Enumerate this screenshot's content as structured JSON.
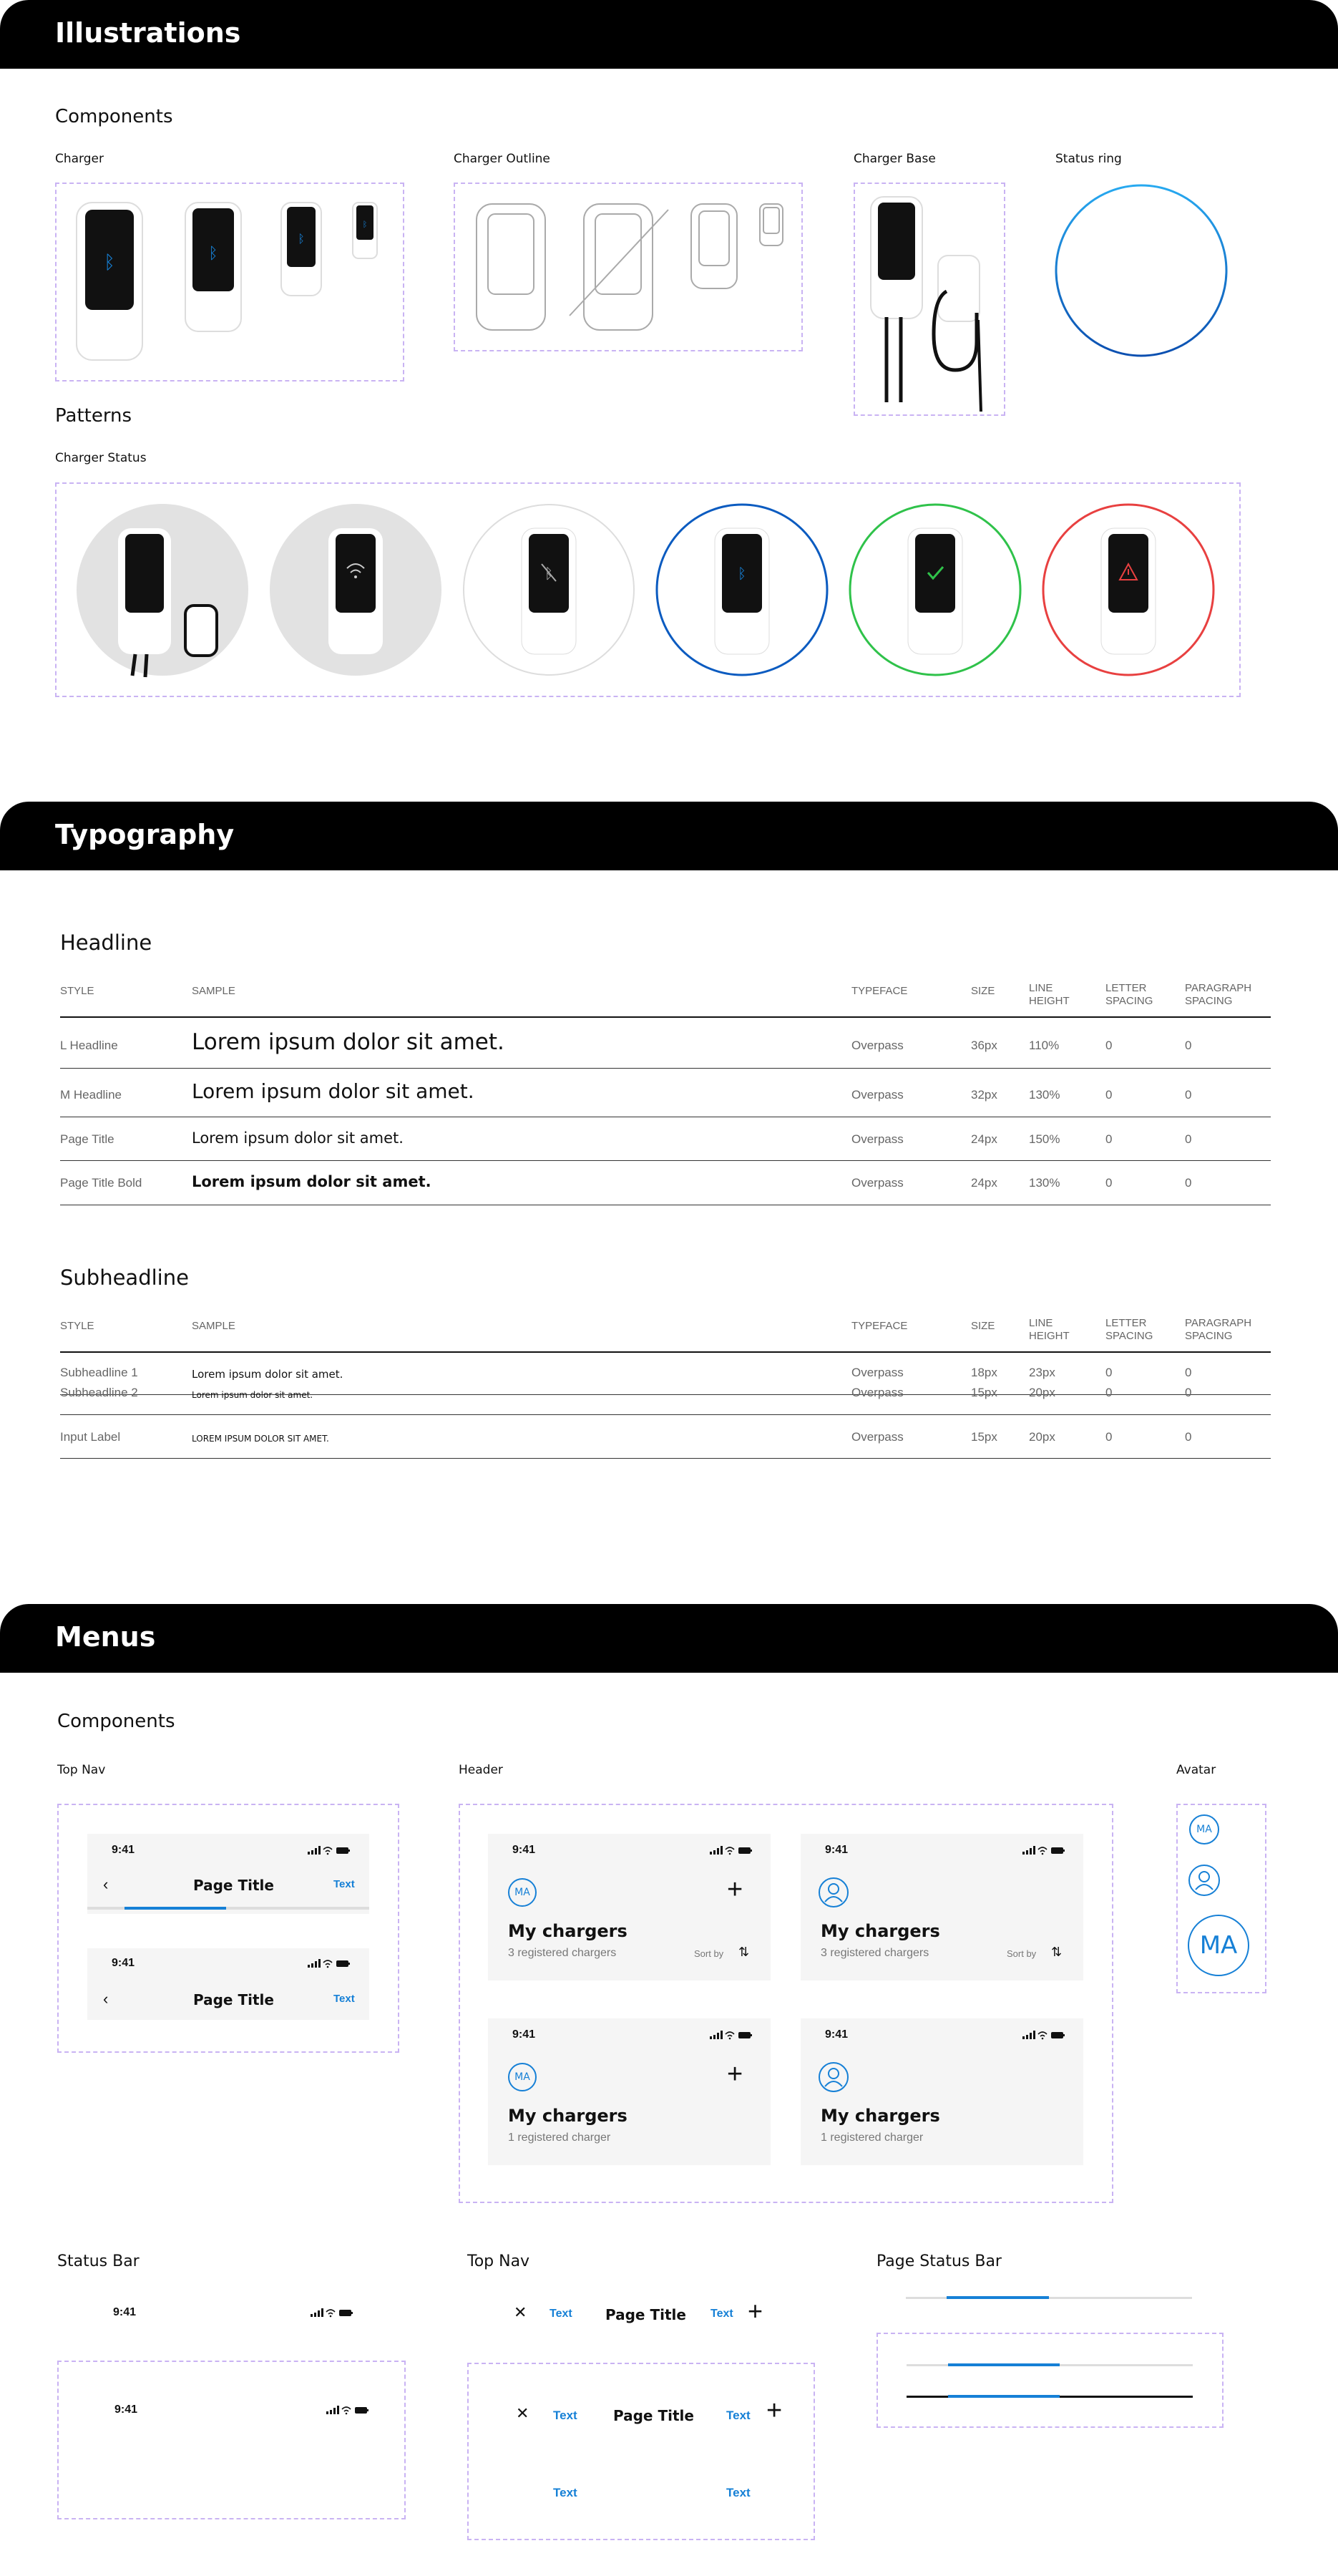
{
  "sections": {
    "illustrations": "Illustrations",
    "typography": "Typography",
    "menus": "Menus"
  },
  "illustrations": {
    "components_title": "Components",
    "charger_label": "Charger",
    "charger_outline_label": "Charger Outline",
    "charger_base_label": "Charger Base",
    "status_ring_label": "Status ring",
    "patterns_title": "Patterns",
    "charger_status_label": "Charger Status"
  },
  "typography": {
    "headline_title": "Headline",
    "subheadline_title": "Subheadline",
    "columns": [
      "STYLE",
      "SAMPLE",
      "TYPEFACE",
      "SIZE",
      "LINE HEIGHT",
      "LETTER SPACING",
      "PARAGRAPH SPACING"
    ],
    "headline_rows": [
      {
        "style": "L Headline",
        "sample": "Lorem ipsum dolor sit amet.",
        "typeface": "Overpass",
        "size": "36px",
        "line_height": "110%",
        "letter": "0",
        "paragraph": "0"
      },
      {
        "style": "M Headline",
        "sample": "Lorem ipsum dolor sit amet.",
        "typeface": "Overpass",
        "size": "32px",
        "line_height": "130%",
        "letter": "0",
        "paragraph": "0"
      },
      {
        "style": "Page Title",
        "sample": "Lorem ipsum dolor sit amet.",
        "typeface": "Overpass",
        "size": "24px",
        "line_height": "150%",
        "letter": "0",
        "paragraph": "0"
      },
      {
        "style": "Page Title Bold",
        "sample": "Lorem ipsum dolor sit amet.",
        "typeface": "Overpass",
        "size": "24px",
        "line_height": "130%",
        "letter": "0",
        "paragraph": "0"
      }
    ],
    "subheadline_rows": [
      {
        "style": "Subheadline 1",
        "sample": "Lorem ipsum dolor sit amet.",
        "typeface": "Overpass",
        "size": "18px",
        "line_height": "23px",
        "letter": "0",
        "paragraph": "0"
      },
      {
        "style": "Subheadline 2",
        "sample": "Lorem ipsum dolor sit amet.",
        "typeface": "Overpass",
        "size": "15px",
        "line_height": "20px",
        "letter": "0",
        "paragraph": "0"
      },
      {
        "style": "Input Label",
        "sample": "LOREM IPSUM DOLOR SIT AMET.",
        "typeface": "Overpass",
        "size": "15px",
        "line_height": "20px",
        "letter": "0",
        "paragraph": "0"
      }
    ]
  },
  "menus": {
    "components_title": "Components",
    "top_nav_label": "Top Nav",
    "header_label": "Header",
    "avatar_label": "Avatar",
    "status_bar_label": "Status Bar",
    "top_nav2_label": "Top Nav",
    "page_status_bar_label": "Page Status Bar",
    "time": "9:41",
    "page_title": "Page Title",
    "text_link": "Text",
    "avatar_initials": "MA",
    "header_title": "My chargers",
    "header_sub_plural": "3 registered chargers",
    "header_sub_single": "1 registered charger",
    "sort_by": "Sort by"
  },
  "colors": {
    "accent": "#1680d6",
    "dashed_border": "#c9b3f3",
    "success": "#2fc24a",
    "error": "#e84040"
  }
}
